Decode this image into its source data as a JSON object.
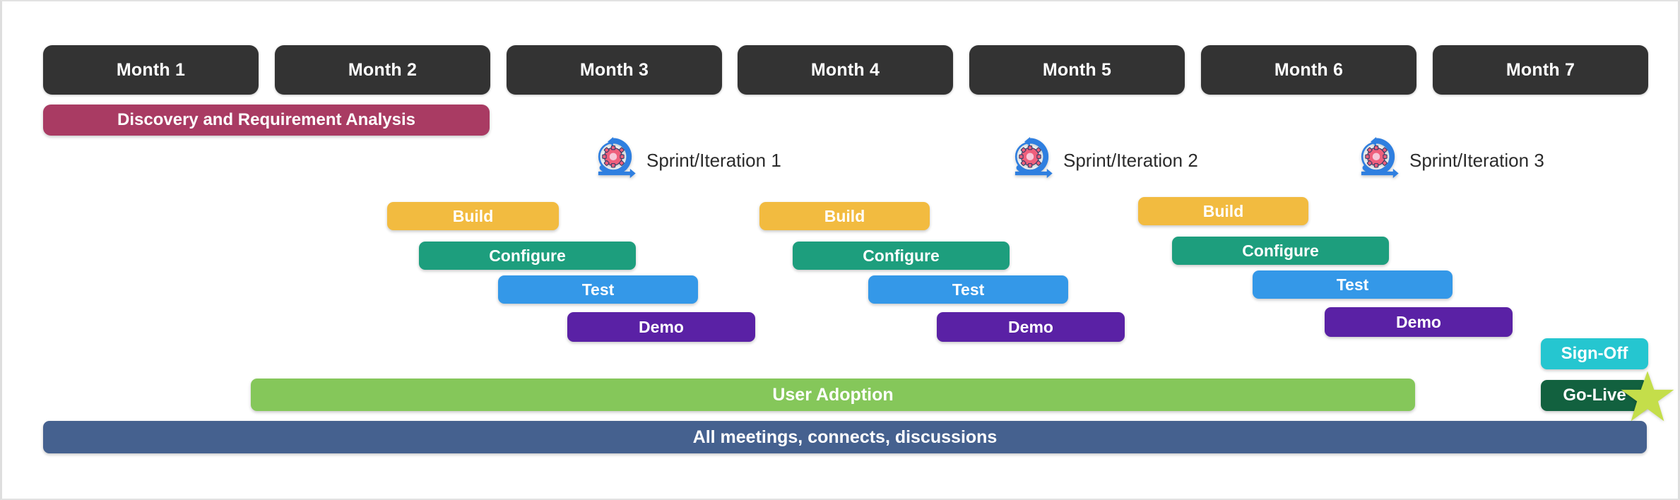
{
  "chart_data": {
    "type": "bar",
    "title": "",
    "subtitle": "",
    "xlabel": "",
    "ylabel": "",
    "axis": {
      "unit": "month",
      "ticks": [
        "Month 1",
        "Month 2",
        "Month 3",
        "Month 4",
        "Month 5",
        "Month 6",
        "Month 7"
      ],
      "range": [
        1,
        7
      ],
      "grid": false
    },
    "legend": {
      "visible": false,
      "position": "none"
    },
    "series": [
      {
        "name": "Discovery and Requirement Analysis",
        "start_month": 1.0,
        "end_month": 3.07,
        "color": "#a93b63",
        "row": 1
      },
      {
        "name": "Build",
        "start_month": 2.03,
        "end_month": 2.53,
        "color": "#f2bb40",
        "row": 3,
        "sprint": 1
      },
      {
        "name": "Configure",
        "start_month": 2.14,
        "end_month": 2.78,
        "color": "#1d9e7d",
        "row": 4,
        "sprint": 1
      },
      {
        "name": "Test",
        "start_month": 2.37,
        "end_month": 2.95,
        "color": "#3498e8",
        "row": 5,
        "sprint": 1
      },
      {
        "name": "Demo",
        "start_month": 2.58,
        "end_month": 3.13,
        "color": "#5a21a5",
        "row": 6,
        "sprint": 1
      },
      {
        "name": "Build",
        "start_month": 3.1,
        "end_month": 3.6,
        "color": "#f2bb40",
        "row": 3,
        "sprint": 2
      },
      {
        "name": "Configure",
        "start_month": 3.22,
        "end_month": 3.84,
        "color": "#1d9e7d",
        "row": 4,
        "sprint": 2
      },
      {
        "name": "Test",
        "start_month": 3.44,
        "end_month": 4.02,
        "color": "#3498e8",
        "row": 5,
        "sprint": 2
      },
      {
        "name": "Demo",
        "start_month": 3.64,
        "end_month": 4.19,
        "color": "#5a21a5",
        "row": 6,
        "sprint": 2
      },
      {
        "name": "Build",
        "start_month": 4.18,
        "end_month": 4.68,
        "color": "#f2bb40",
        "row": 3,
        "sprint": 3
      },
      {
        "name": "Configure",
        "start_month": 4.29,
        "end_month": 4.92,
        "color": "#1d9e7d",
        "row": 4,
        "sprint": 3
      },
      {
        "name": "Test",
        "start_month": 4.52,
        "end_month": 5.1,
        "color": "#3498e8",
        "row": 5,
        "sprint": 3
      },
      {
        "name": "Demo",
        "start_month": 4.72,
        "end_month": 5.27,
        "color": "#5a21a5",
        "row": 6,
        "sprint": 3
      },
      {
        "name": "Sign-Off",
        "start_month": 6.34,
        "end_month": 6.8,
        "color": "#25c6d0",
        "row": 7
      },
      {
        "name": "User Adoption",
        "start_month": 1.62,
        "end_month": 6.07,
        "color": "#85c75a",
        "row": 8
      },
      {
        "name": "Go-Live",
        "start_month": 6.34,
        "end_month": 6.8,
        "color": "#12613f",
        "row": 8
      },
      {
        "name": "All meetings, connects, discussions",
        "start_month": 1.0,
        "end_month": 7.0,
        "color": "#45618f",
        "row": 9
      }
    ],
    "milestones": [
      {
        "name": "Sprint/Iteration 1",
        "month": 2.55
      },
      {
        "name": "Sprint/Iteration 2",
        "month": 3.7
      },
      {
        "name": "Sprint/Iteration 3",
        "month": 4.7
      }
    ]
  },
  "colors": {
    "month_header": "#333333",
    "discovery": "#a93b63",
    "build": "#f2bb40",
    "configure": "#1d9e7d",
    "test": "#3498e8",
    "demo": "#5a21a5",
    "sign_off": "#25c6d0",
    "go_live": "#12613f",
    "user_adoption": "#85c75a",
    "meetings": "#45618f",
    "star": "#c4de4a",
    "sprint_icon_ring": "#2f7fe0",
    "sprint_icon_gear": "#ef5f7c",
    "canvas": "#ffffff"
  },
  "timeline": {
    "months": [
      {
        "label": "Month 1"
      },
      {
        "label": "Month 2"
      },
      {
        "label": "Month 3"
      },
      {
        "label": "Month 4"
      },
      {
        "label": "Month 5"
      },
      {
        "label": "Month 6"
      },
      {
        "label": "Month 7"
      }
    ],
    "discovery": {
      "label": "Discovery and Requirement Analysis"
    },
    "sprints": [
      {
        "marker_label": "Sprint/Iteration 1",
        "icon": "agile-sprint-icon",
        "tasks": [
          {
            "label": "Build"
          },
          {
            "label": "Configure"
          },
          {
            "label": "Test"
          },
          {
            "label": "Demo"
          }
        ]
      },
      {
        "marker_label": "Sprint/Iteration 2",
        "icon": "agile-sprint-icon",
        "tasks": [
          {
            "label": "Build"
          },
          {
            "label": "Configure"
          },
          {
            "label": "Test"
          },
          {
            "label": "Demo"
          }
        ]
      },
      {
        "marker_label": "Sprint/Iteration 3",
        "icon": "agile-sprint-icon",
        "tasks": [
          {
            "label": "Build"
          },
          {
            "label": "Configure"
          },
          {
            "label": "Test"
          },
          {
            "label": "Demo"
          }
        ]
      }
    ],
    "sign_off": {
      "label": "Sign-Off"
    },
    "go_live": {
      "label": "Go-Live",
      "icon": "star-icon"
    },
    "user_adoption": {
      "label": "User Adoption"
    },
    "meetings": {
      "label": "All meetings, connects, discussions"
    }
  }
}
